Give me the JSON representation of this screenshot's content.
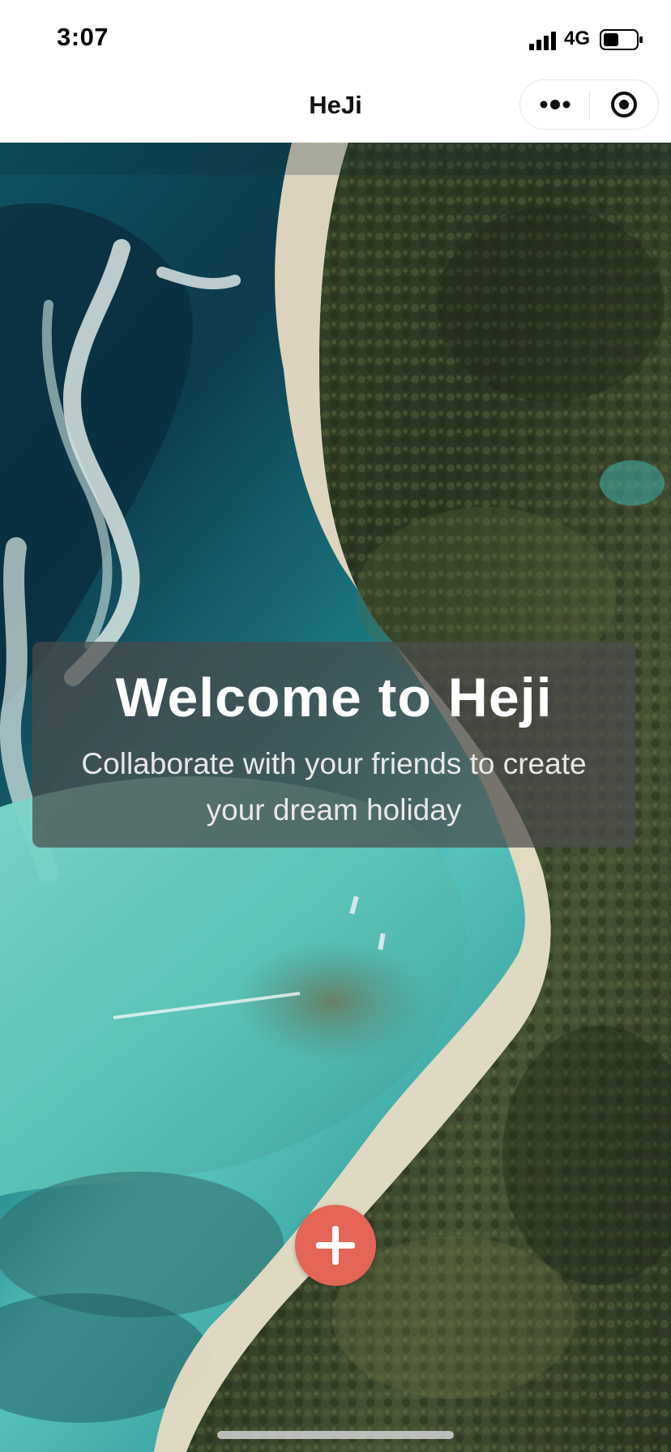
{
  "status_bar": {
    "time": "3:07",
    "network": "4G",
    "icons": [
      "signal-icon",
      "battery-icon"
    ]
  },
  "nav_bar": {
    "title": "HeJi",
    "more_icon": "more-dots-icon",
    "close_icon": "target-icon"
  },
  "welcome": {
    "title": "Welcome to Heji",
    "subtitle": "Collaborate with your friends to create your dream holiday"
  },
  "actions": {
    "add_icon": "plus-icon",
    "add_color": "#e46456"
  },
  "colors": {
    "ocean_deep": "#0f4f5f",
    "ocean_light": "#6fd0c6",
    "sand": "#e9dcc4",
    "forest": "#2b3a1f"
  }
}
